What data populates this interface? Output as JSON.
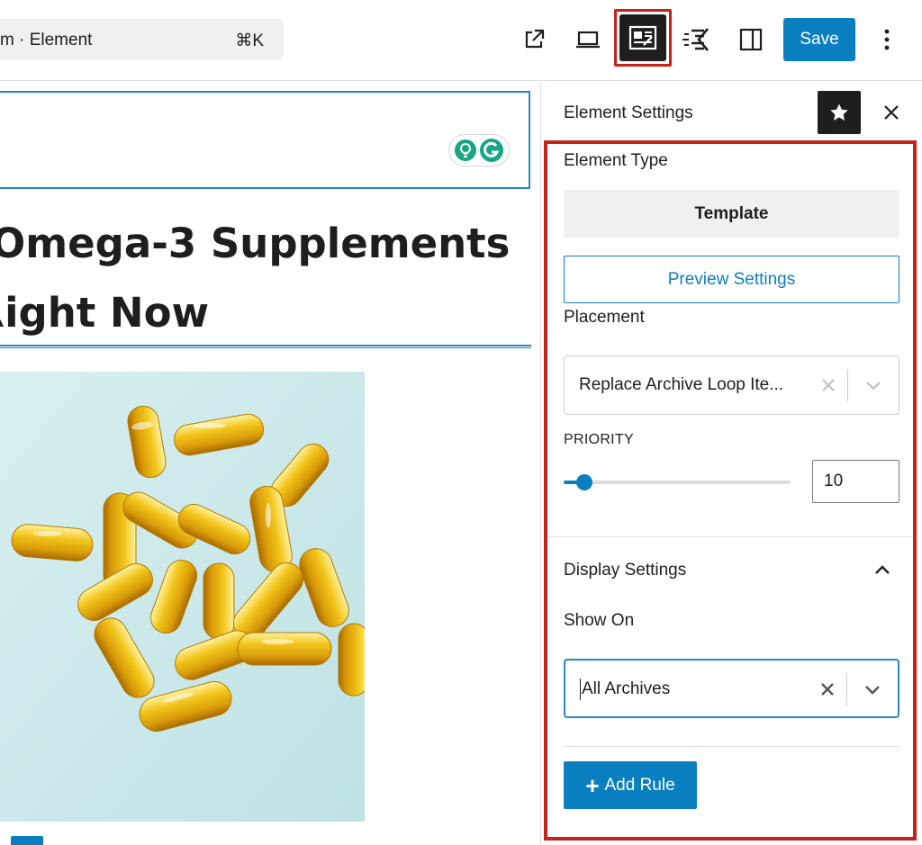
{
  "toolbar": {
    "command_bar_text": "m · Element",
    "command_shortcut": "⌘K",
    "save_label": "Save",
    "icons": [
      "external-link-icon",
      "desktop-preview-icon",
      "template-editor-icon",
      "generateblocks-icon",
      "sidebar-toggle-icon",
      "more-options-icon"
    ]
  },
  "canvas": {
    "heading_line1": "Omega-3 Supplements",
    "heading_line2": "ket Right Now",
    "photo_subject": "fish-oil-capsules-image"
  },
  "panel": {
    "title": "Element Settings",
    "element_type_label": "Element Type",
    "element_type_value": "Template",
    "preview_settings_label": "Preview Settings",
    "placement_label": "Placement",
    "placement_value": "Replace Archive Loop Ite...",
    "priority_label": "PRIORITY",
    "priority_value": "10",
    "priority_fraction": 0.09,
    "display_settings_label": "Display Settings",
    "show_on_label": "Show On",
    "show_on_value": "All Archives",
    "add_rule_label": "Add Rule"
  },
  "colors": {
    "accent": "#0a7fc0",
    "highlight": "#c4221a",
    "dark": "#1e1e1e"
  }
}
